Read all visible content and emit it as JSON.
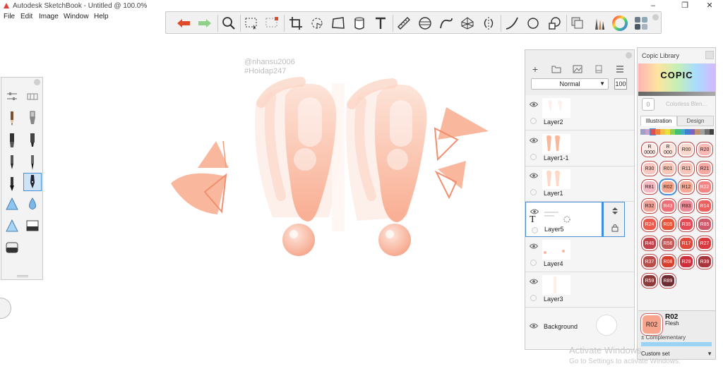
{
  "window": {
    "title": "Autodesk SketchBook - Untitled @ 100.0%",
    "minimize": "–",
    "maximize": "❐",
    "close": "✕"
  },
  "menu": [
    "File",
    "Edit",
    "Image",
    "Window",
    "Help"
  ],
  "toolbar": {
    "tools": [
      "undo-icon",
      "redo-icon",
      "zoom-icon",
      "rect-select-icon",
      "lasso-select-icon",
      "crop-icon",
      "transform-icon",
      "distort-icon",
      "fill-bucket-icon",
      "text-icon",
      "ruler-icon",
      "ellipse-guide-icon",
      "french-curve-icon",
      "perspective-icon",
      "symmetry-icon",
      "stroke-icon",
      "circle-icon",
      "shape-icon",
      "layer-editor-icon",
      "brush-library-icon",
      "color-wheel-icon",
      "palette-icon"
    ]
  },
  "watermark": {
    "line1": "@nhansu2006",
    "line2": "#Hoidap247"
  },
  "layers": {
    "blend_mode": "Normal",
    "opacity": "100",
    "items": [
      {
        "name": "Layer2",
        "selected": false
      },
      {
        "name": "Layer1-1",
        "selected": false
      },
      {
        "name": "Layer1",
        "selected": false
      },
      {
        "name": "Layer5",
        "selected": true
      },
      {
        "name": "Layer4",
        "selected": false
      },
      {
        "name": "Layer3",
        "selected": false
      },
      {
        "name": "Background",
        "selected": false
      }
    ]
  },
  "copic": {
    "title": "Copic Library",
    "logo": "COPIC",
    "colorless_code": "0",
    "colorless_label": "Colorless Blen...",
    "tabs": [
      "Illustration",
      "Design"
    ],
    "active_tab": "Illustration",
    "chips": [
      {
        "code": "R 0000",
        "color": "#fde9e3"
      },
      {
        "code": "R 000",
        "color": "#fde2da"
      },
      {
        "code": "R00",
        "color": "#fcd7cc"
      },
      {
        "code": "R20",
        "color": "#f9b9b5"
      },
      {
        "code": "R30",
        "color": "#f9c8c2"
      },
      {
        "code": "R01",
        "color": "#fac8b8"
      },
      {
        "code": "R11",
        "color": "#f8c3b8"
      },
      {
        "code": "R21",
        "color": "#f6a9a2"
      },
      {
        "code": "R81",
        "color": "#f6b9c3"
      },
      {
        "code": "R02",
        "color": "#f7a58c"
      },
      {
        "code": "R12",
        "color": "#f5a994"
      },
      {
        "code": "R22",
        "color": "#f28684"
      },
      {
        "code": "R32",
        "color": "#f1a399"
      },
      {
        "code": "R43",
        "color": "#ef6f78"
      },
      {
        "code": "R83",
        "color": "#ee8b98"
      },
      {
        "code": "R14",
        "color": "#ee6060"
      },
      {
        "code": "R24",
        "color": "#eb5a4e"
      },
      {
        "code": "R05",
        "color": "#e9553b"
      },
      {
        "code": "R35",
        "color": "#e44a55"
      },
      {
        "code": "R85",
        "color": "#cb5a6a"
      },
      {
        "code": "R46",
        "color": "#c0424a"
      },
      {
        "code": "R56",
        "color": "#c45a58"
      },
      {
        "code": "R17",
        "color": "#e0483c"
      },
      {
        "code": "R27",
        "color": "#d83a3e"
      },
      {
        "code": "R37",
        "color": "#b84c4a"
      },
      {
        "code": "R08",
        "color": "#d8402e"
      },
      {
        "code": "R29",
        "color": "#cf2e3c"
      },
      {
        "code": "R39",
        "color": "#a8343c"
      },
      {
        "code": "R59",
        "color": "#8c3a3a"
      },
      {
        "code": "R89",
        "color": "#6e2c33"
      }
    ],
    "selected_code": "R02",
    "current": {
      "code": "R02",
      "name": "Flesh",
      "complementary": "± Complementary",
      "set": "Custom set"
    }
  },
  "system": {
    "activate_title": "Activate Windows",
    "activate_sub": "Go to Settings to activate Windows."
  },
  "colors": {
    "accent": "#4a90d9",
    "art_peach": "#f9b79c",
    "undo_red": "#e04a2c",
    "redo_green": "#7ec67a"
  }
}
